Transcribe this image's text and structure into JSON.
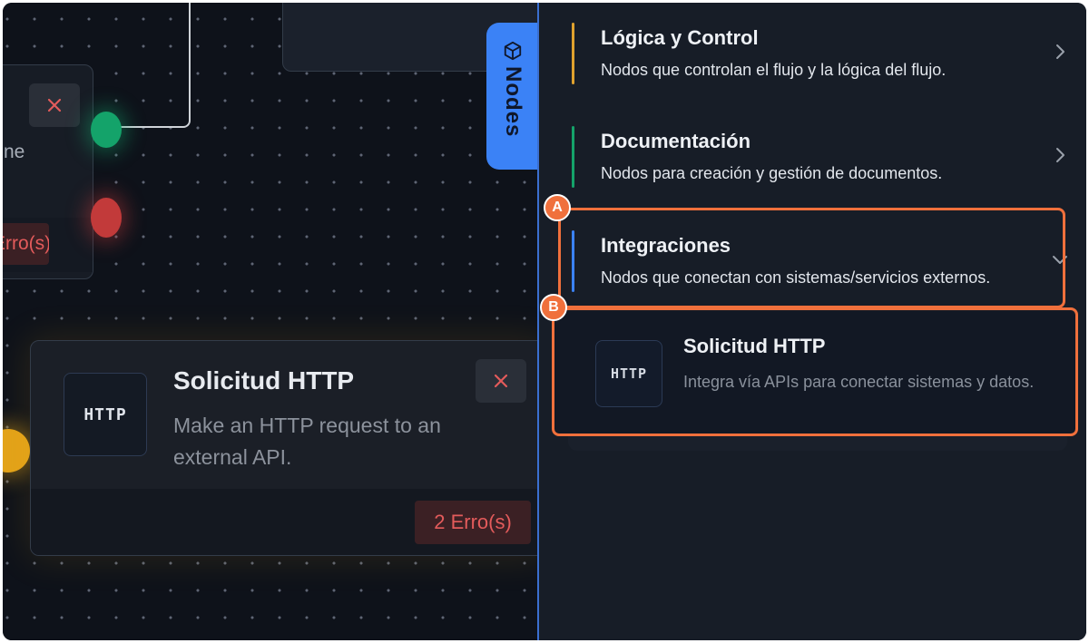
{
  "canvas": {
    "left_node": {
      "partial_text": "ne",
      "error_badge": "Erro(s)"
    },
    "http_node": {
      "icon_text": "HTTP",
      "title": "Solicitud HTTP",
      "description": "Make an HTTP request to an external API.",
      "error_badge": "2 Erro(s)"
    },
    "nodes_tab": {
      "label": "Nodes",
      "icon": "cube-icon"
    },
    "port_colors": {
      "success": "#14a36a",
      "error": "#c23a3a",
      "input": "#e3a319"
    }
  },
  "panel": {
    "categories": [
      {
        "name": "Lógica y Control",
        "description": "Nodos que controlan el flujo y la lógica del flujo.",
        "accent": "#e0a22e",
        "chevron": "chevron-right-icon"
      },
      {
        "name": "Documentación",
        "description": "Nodos para creación y gestión de documentos.",
        "accent": "#14a36a",
        "chevron": "chevron-right-icon"
      },
      {
        "name": "Integraciones",
        "description": "Nodos que conectan con sistemas/servicios externos.",
        "accent": "#3b82f6",
        "chevron": "chevron-down-icon"
      }
    ],
    "node_items": [
      {
        "icon_text": "HTTP",
        "title": "Solicitud HTTP",
        "description": "Integra vía APIs para conectar sistemas y datos."
      }
    ]
  },
  "annotations": {
    "a": "A",
    "b": "B",
    "color": "#f0703c"
  }
}
